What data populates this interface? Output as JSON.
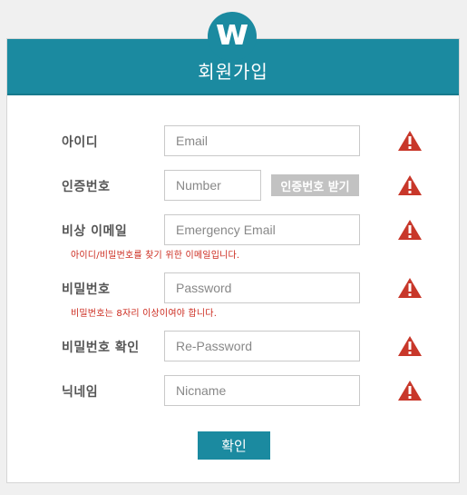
{
  "header": {
    "title": "회원가입",
    "logo_letter": "w"
  },
  "form": {
    "fields": [
      {
        "label": "아이디",
        "placeholder": "Email"
      },
      {
        "label": "인증번호",
        "placeholder": "Number",
        "button_label": "인증번호 받기"
      },
      {
        "label": "비상 이메일",
        "placeholder": "Emergency Email",
        "hint": "아이디/비밀번호를 찾기 위한 이메일입니다."
      },
      {
        "label": "비밀번호",
        "placeholder": "Password",
        "hint": "비밀번호는 8자리 이상이여야 합니다."
      },
      {
        "label": "비밀번호 확인",
        "placeholder": "Re-Password"
      },
      {
        "label": "닉네임",
        "placeholder": "Nicname"
      }
    ],
    "submit_label": "확인"
  },
  "icons": {
    "warning": "warning-triangle-icon"
  },
  "colors": {
    "accent": "#1b8aa0",
    "warning": "#c8372a",
    "hint_text": "#cc2a1e",
    "disabled_button": "#c2c2c2"
  }
}
